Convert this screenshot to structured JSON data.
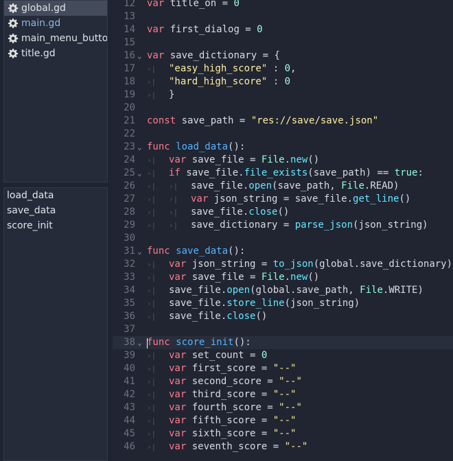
{
  "scripts": [
    {
      "label": "global.gd",
      "icon": "gear-icon"
    },
    {
      "label": "main.gd",
      "icon": "gear-icon"
    },
    {
      "label": "main_menu_buttons.gd",
      "icon": "gear-icon"
    },
    {
      "label": "title.gd",
      "icon": "gear-icon"
    }
  ],
  "methods": [
    "load_data",
    "save_data",
    "score_init"
  ],
  "editor": {
    "lines": [
      {
        "n": "12",
        "code": "var title_on = 0"
      },
      {
        "n": "13",
        "code": ""
      },
      {
        "n": "14",
        "code": "var first_dialog = 0"
      },
      {
        "n": "15",
        "code": ""
      },
      {
        "n": "16",
        "code": "var save_dictionary = {"
      },
      {
        "n": "17",
        "code": "\"easy_high_score\" : 0,"
      },
      {
        "n": "18",
        "code": "\"hard_high_score\" : 0"
      },
      {
        "n": "19",
        "code": "}"
      },
      {
        "n": "20",
        "code": ""
      },
      {
        "n": "21",
        "code": "const save_path = \"res://save/save.json\""
      },
      {
        "n": "22",
        "code": ""
      },
      {
        "n": "23",
        "code": "func load_data():"
      },
      {
        "n": "24",
        "code": "var save_file = File.new()"
      },
      {
        "n": "25",
        "code": "if save_file.file_exists(save_path) == true:"
      },
      {
        "n": "26",
        "code": "save_file.open(save_path, File.READ)"
      },
      {
        "n": "27",
        "code": "var json_string = save_file.get_line()"
      },
      {
        "n": "28",
        "code": "save_file.close()"
      },
      {
        "n": "29",
        "code": "save_dictionary = parse_json(json_string)"
      },
      {
        "n": "30",
        "code": ""
      },
      {
        "n": "31",
        "code": "func save_data():"
      },
      {
        "n": "32",
        "code": "var json_string = to_json(global.save_dictionary)"
      },
      {
        "n": "33",
        "code": "var save_file = File.new()"
      },
      {
        "n": "34",
        "code": "save_file.open(global.save_path, File.WRITE)"
      },
      {
        "n": "35",
        "code": "save_file.store_line(json_string)"
      },
      {
        "n": "36",
        "code": "save_file.close()"
      },
      {
        "n": "37",
        "code": ""
      },
      {
        "n": "38",
        "code": "func score_init():"
      },
      {
        "n": "39",
        "code": "var set_count = 0"
      },
      {
        "n": "40",
        "code": "var first_score = \"--\""
      },
      {
        "n": "41",
        "code": "var second_score = \"--\""
      },
      {
        "n": "42",
        "code": "var third_score = \"--\""
      },
      {
        "n": "43",
        "code": "var fourth_score = \"--\""
      },
      {
        "n": "44",
        "code": "var fifth_score = \"--\""
      },
      {
        "n": "45",
        "code": "var sixth_score = \"--\""
      },
      {
        "n": "46",
        "code": "var seventh_score = \"--\""
      }
    ]
  }
}
